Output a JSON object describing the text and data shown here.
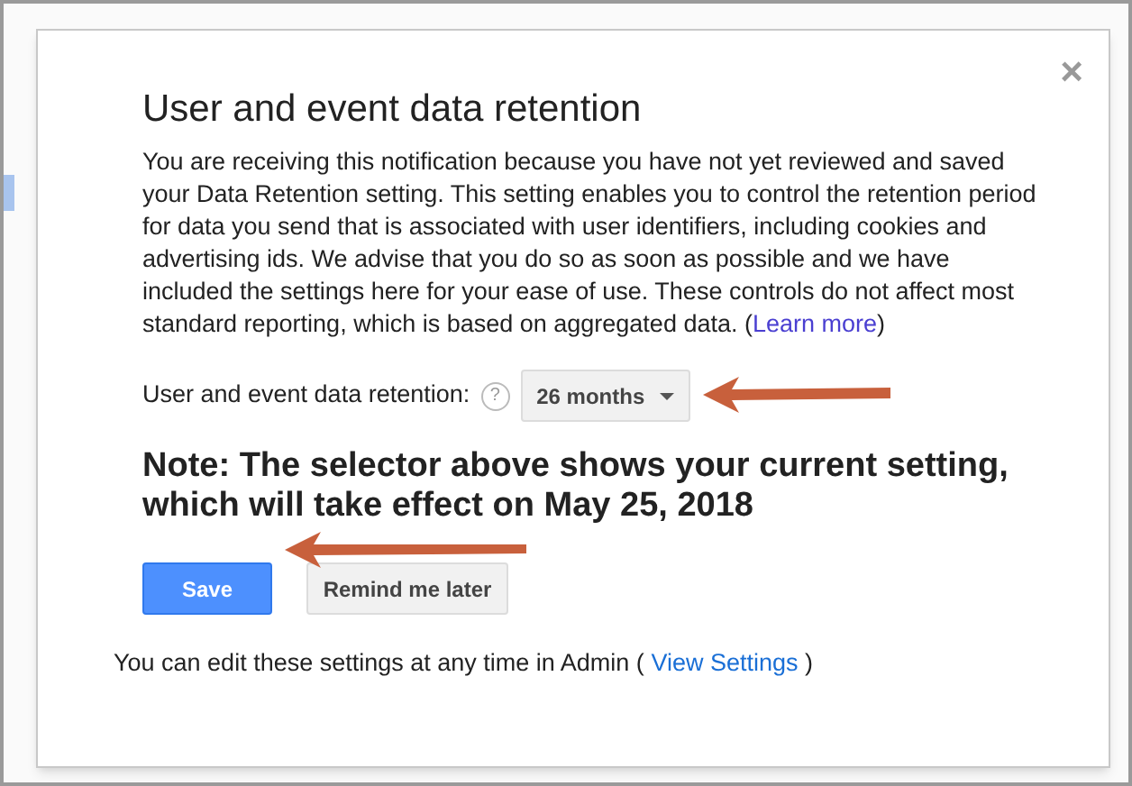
{
  "dialog": {
    "title": "User and event data retention",
    "body": {
      "text": "You are receiving this notification because you have not yet reviewed and saved your Data Retention setting. This setting enables you to control the retention period for data you send that is associated with user identifiers, including cookies and advertising ids. We advise that you do so as soon as possible and we have included the settings here for your ease of use. These controls do not affect most standard reporting, which is based on aggregated data. (",
      "link": "Learn more",
      "after": ")"
    },
    "setting": {
      "label": "User and event data retention:",
      "help": "?",
      "value": "26 months"
    },
    "note": "Note: The selector above shows your current setting, which will take effect on May 25, 2018",
    "buttons": [
      {
        "label": "Save",
        "kind": "primary"
      },
      {
        "label": "Remind me later",
        "kind": "secondary"
      }
    ],
    "footer": {
      "text": "You can edit these settings at any time in Admin (",
      "link": "View Settings",
      "after": ")"
    },
    "close": "×"
  }
}
